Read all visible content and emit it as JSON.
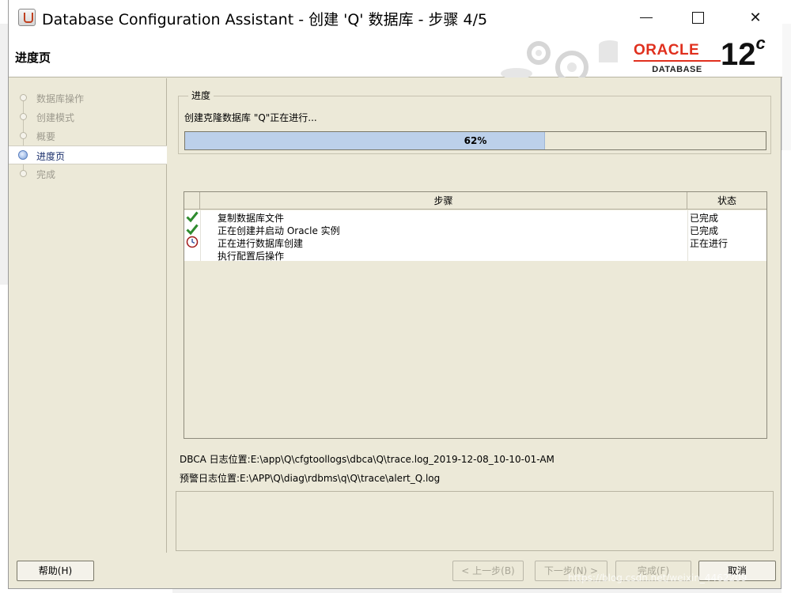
{
  "window": {
    "title": "Database Configuration Assistant - 创建 'Q' 数据库 - 步骤 4/5",
    "minimize_glyph": "",
    "maximize_glyph": "",
    "close_glyph": "✕"
  },
  "header": {
    "page_title": "进度页",
    "brand": "ORACLE",
    "brand_sub": "DATABASE",
    "version": "12",
    "version_suffix": "c"
  },
  "nav": {
    "items": [
      {
        "label": "数据库操作",
        "state": "done"
      },
      {
        "label": "创建模式",
        "state": "done"
      },
      {
        "label": "概要",
        "state": "done"
      },
      {
        "label": "进度页",
        "state": "active"
      },
      {
        "label": "完成",
        "state": "pending"
      }
    ]
  },
  "progress": {
    "group_label": "进度",
    "message": "创建克隆数据库 \"Q\"正在进行...",
    "percent_text": "62%",
    "value": 0.62
  },
  "steps_table": {
    "headers": {
      "icon": "",
      "step": "步骤",
      "status": "状态"
    },
    "rows": [
      {
        "icon": "check-icon",
        "step": "复制数据库文件",
        "status": "已完成"
      },
      {
        "icon": "check-icon",
        "step": "正在创建并启动 Oracle 实例",
        "status": "已完成"
      },
      {
        "icon": "clock-icon",
        "step": "正在进行数据库创建",
        "status": "正在进行"
      },
      {
        "icon": "",
        "step": "执行配置后操作",
        "status": ""
      }
    ]
  },
  "logs": {
    "dbca": "DBCA 日志位置:E:\\app\\Q\\cfgtoollogs\\dbca\\Q\\trace.log_2019-12-08_10-10-01-AM",
    "alert": "预警日志位置:E:\\APP\\Q\\diag\\rdbms\\q\\Q\\trace\\alert_Q.log"
  },
  "buttons": {
    "help": "帮助(H)",
    "prev": "< 上一步(B)",
    "next": "下一步(N) >",
    "finish": "完成(F)",
    "cancel": "取消"
  },
  "watermark": "https://blog.csdn.net/weixin_4462209",
  "colors": {
    "window_bg": "#ece9d8",
    "progress_fill": "#bcd0ea",
    "oracle_red": "#e0301e",
    "check_green": "#2e8b2e"
  }
}
